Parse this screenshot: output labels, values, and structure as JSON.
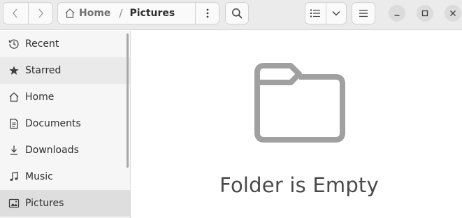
{
  "header": {
    "breadcrumb": {
      "home_label": "Home",
      "separator": "/",
      "current_label": "Pictures"
    }
  },
  "sidebar": {
    "items": [
      {
        "label": "Recent",
        "icon": "clock-icon"
      },
      {
        "label": "Starred",
        "icon": "star-icon"
      },
      {
        "label": "Home",
        "icon": "home-icon"
      },
      {
        "label": "Documents",
        "icon": "document-icon"
      },
      {
        "label": "Downloads",
        "icon": "download-icon"
      },
      {
        "label": "Music",
        "icon": "music-icon"
      },
      {
        "label": "Pictures",
        "icon": "picture-icon"
      }
    ],
    "selected": "Pictures"
  },
  "main": {
    "empty_state": {
      "icon": "folder-icon",
      "text": "Folder is Empty"
    }
  },
  "colors": {
    "header_bg": "#ebebeb",
    "sidebar_bg": "#f6f6f6",
    "selected_bg": "#dedede",
    "icon_gray": "#a0a0a0"
  }
}
